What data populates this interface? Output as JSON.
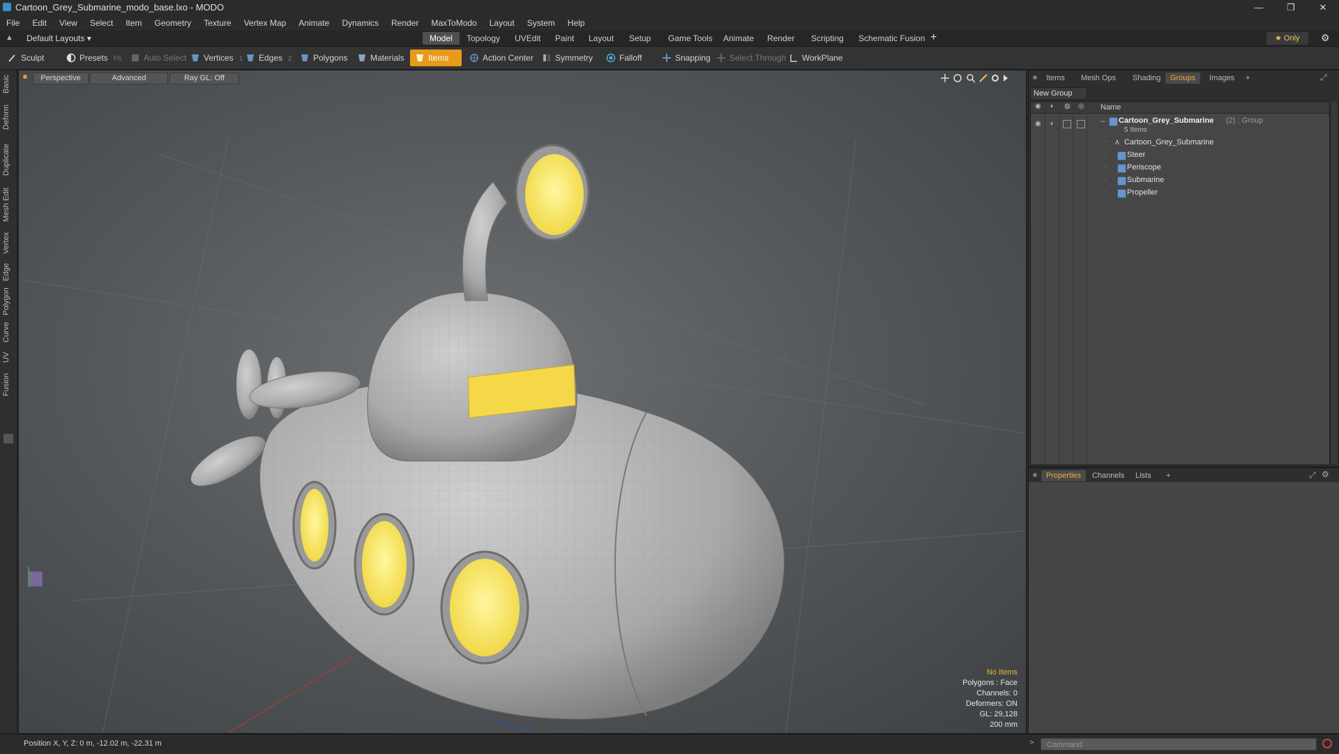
{
  "window": {
    "title": "Cartoon_Grey_Submarine_modo_base.lxo - MODO",
    "minimize": "—",
    "restore": "❐",
    "close": "✕"
  },
  "menu": [
    "File",
    "Edit",
    "View",
    "Select",
    "Item",
    "Geometry",
    "Texture",
    "Vertex Map",
    "Animate",
    "Dynamics",
    "Render",
    "MaxToModo",
    "Layout",
    "System",
    "Help"
  ],
  "layout_bar": {
    "layout_selector": "Default Layouts ▾",
    "tabs": [
      "Model",
      "Topology",
      "UVEdit",
      "Paint",
      "Layout",
      "Setup",
      "Game Tools",
      "Animate",
      "Render",
      "Scripting",
      "Schematic Fusion"
    ],
    "active_tab": "Model",
    "add": "+",
    "only": "★  Only",
    "gear": "⚙"
  },
  "toolbar": {
    "sculpt": "Sculpt",
    "presets": "Presets",
    "presets_key": "F6",
    "auto_select": "Auto Select",
    "vertices": "Vertices",
    "vertices_key": "1",
    "edges": "Edges",
    "edges_key": "2",
    "polygons": "Polygons",
    "materials": "Materials",
    "items": "Items",
    "action_center": "Action Center",
    "symmetry": "Symmetry",
    "falloff": "Falloff",
    "snapping": "Snapping",
    "select_through": "Select Through",
    "workplane": "WorkPlane"
  },
  "left_tabs": [
    "Basic",
    "Deform",
    "Duplicate",
    "Mesh Edit",
    "Vertex",
    "Edge",
    "Polygon",
    "Curve",
    "UV",
    "Fusion"
  ],
  "viewport": {
    "view_mode": "Perspective",
    "shading": "Advanced",
    "raygl": "Ray GL: Off",
    "info": {
      "selection": "No Items",
      "polygons": "Polygons : Face",
      "channels": "Channels: 0",
      "deformers": "Deformers: ON",
      "gl": "GL: 29,128",
      "scale": "200 mm"
    }
  },
  "right_panel": {
    "tabs": [
      "Items",
      "Mesh Ops",
      "Shading",
      "Groups",
      "Images"
    ],
    "active_tab": "Groups",
    "add": "+",
    "new_group": "New Group",
    "column_name": "Name",
    "group": {
      "name": "Cartoon_Grey_Submarine",
      "suffix": " (2) : Group",
      "count": "5 Items"
    },
    "items": [
      "Cartoon_Grey_Submarine",
      "Steer",
      "Periscope",
      "Submarine",
      "Propeller"
    ]
  },
  "properties_panel": {
    "tabs": [
      "Properties",
      "Channels",
      "Lists"
    ],
    "active_tab": "Properties",
    "add": "+"
  },
  "status": {
    "position": "Position X, Y, Z:  0 m, -12.02 m, -22.31 m",
    "command_placeholder": "Command"
  },
  "colors": {
    "accent": "#e89a1a",
    "porthole_yellow": "#f6e35a",
    "hull_grey": "#b4b4b4"
  }
}
